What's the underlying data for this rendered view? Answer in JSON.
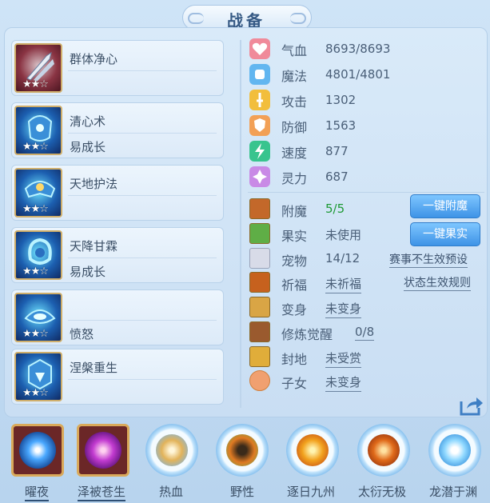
{
  "title": "战备",
  "skills": [
    {
      "name": "群体净心",
      "sub": "",
      "stars": "★★☆",
      "icon": "weapon-icon"
    },
    {
      "name": "清心术",
      "sub": "易成长",
      "stars": "★★☆",
      "icon": "armor-icon"
    },
    {
      "name": "天地护法",
      "sub": "",
      "stars": "★★☆",
      "icon": "armor-icon"
    },
    {
      "name": "天降甘霖",
      "sub": "易成长",
      "stars": "★★☆",
      "icon": "armor-icon"
    },
    {
      "name": "",
      "sub": "愤怒",
      "stars": "★★☆",
      "icon": "armor-icon"
    },
    {
      "name": "涅槃重生",
      "sub": "",
      "stars": "★★☆",
      "icon": "armor-icon"
    }
  ],
  "stats": [
    {
      "label": "气血",
      "value": "8693/8693",
      "icon": "heart-icon",
      "color": "#f08a9a"
    },
    {
      "label": "魔法",
      "value": "4801/4801",
      "icon": "mana-icon",
      "color": "#62b6f0"
    },
    {
      "label": "攻击",
      "value": "1302",
      "icon": "sword-icon",
      "color": "#f2be3c"
    },
    {
      "label": "防御",
      "value": "1563",
      "icon": "shield-icon",
      "color": "#f2a056"
    },
    {
      "label": "速度",
      "value": "877",
      "icon": "lightning-icon",
      "color": "#38c48e"
    },
    {
      "label": "灵力",
      "value": "687",
      "icon": "spirit-icon",
      "color": "#c98ae6"
    }
  ],
  "extras": {
    "enchant": {
      "label": "附魔",
      "value": "5/5",
      "value_color": "#1e9a35"
    },
    "fruit": {
      "label": "果实",
      "value": "未使用"
    },
    "pet": {
      "label": "宠物",
      "value": "14/12"
    },
    "pray": {
      "label": "祈福",
      "value": "未祈福"
    },
    "transform": {
      "label": "变身",
      "value": "未变身"
    },
    "cultivate": {
      "label": "修炼觉醒",
      "value": "0/8"
    },
    "fief": {
      "label": "封地",
      "value": "未受赏"
    },
    "child": {
      "label": "子女",
      "value": "未变身"
    }
  },
  "buttons": {
    "enchant": "一键附魔",
    "fruit": "一键果实"
  },
  "links": {
    "contest": "赛事不生效预设",
    "rules": "状态生效规则"
  },
  "bottom_items": [
    {
      "label": "曜夜",
      "icon": "night-orb-icon"
    },
    {
      "label": "泽被苍生",
      "icon": "palm-icon"
    },
    {
      "label": "热血",
      "icon": "warrior-icon"
    },
    {
      "label": "野性",
      "icon": "beast-icon"
    },
    {
      "label": "逐日九州",
      "icon": "sun-ring-icon"
    },
    {
      "label": "太衍无极",
      "icon": "drum-icon"
    },
    {
      "label": "龙潜于渊",
      "icon": "dragon-icon"
    }
  ]
}
